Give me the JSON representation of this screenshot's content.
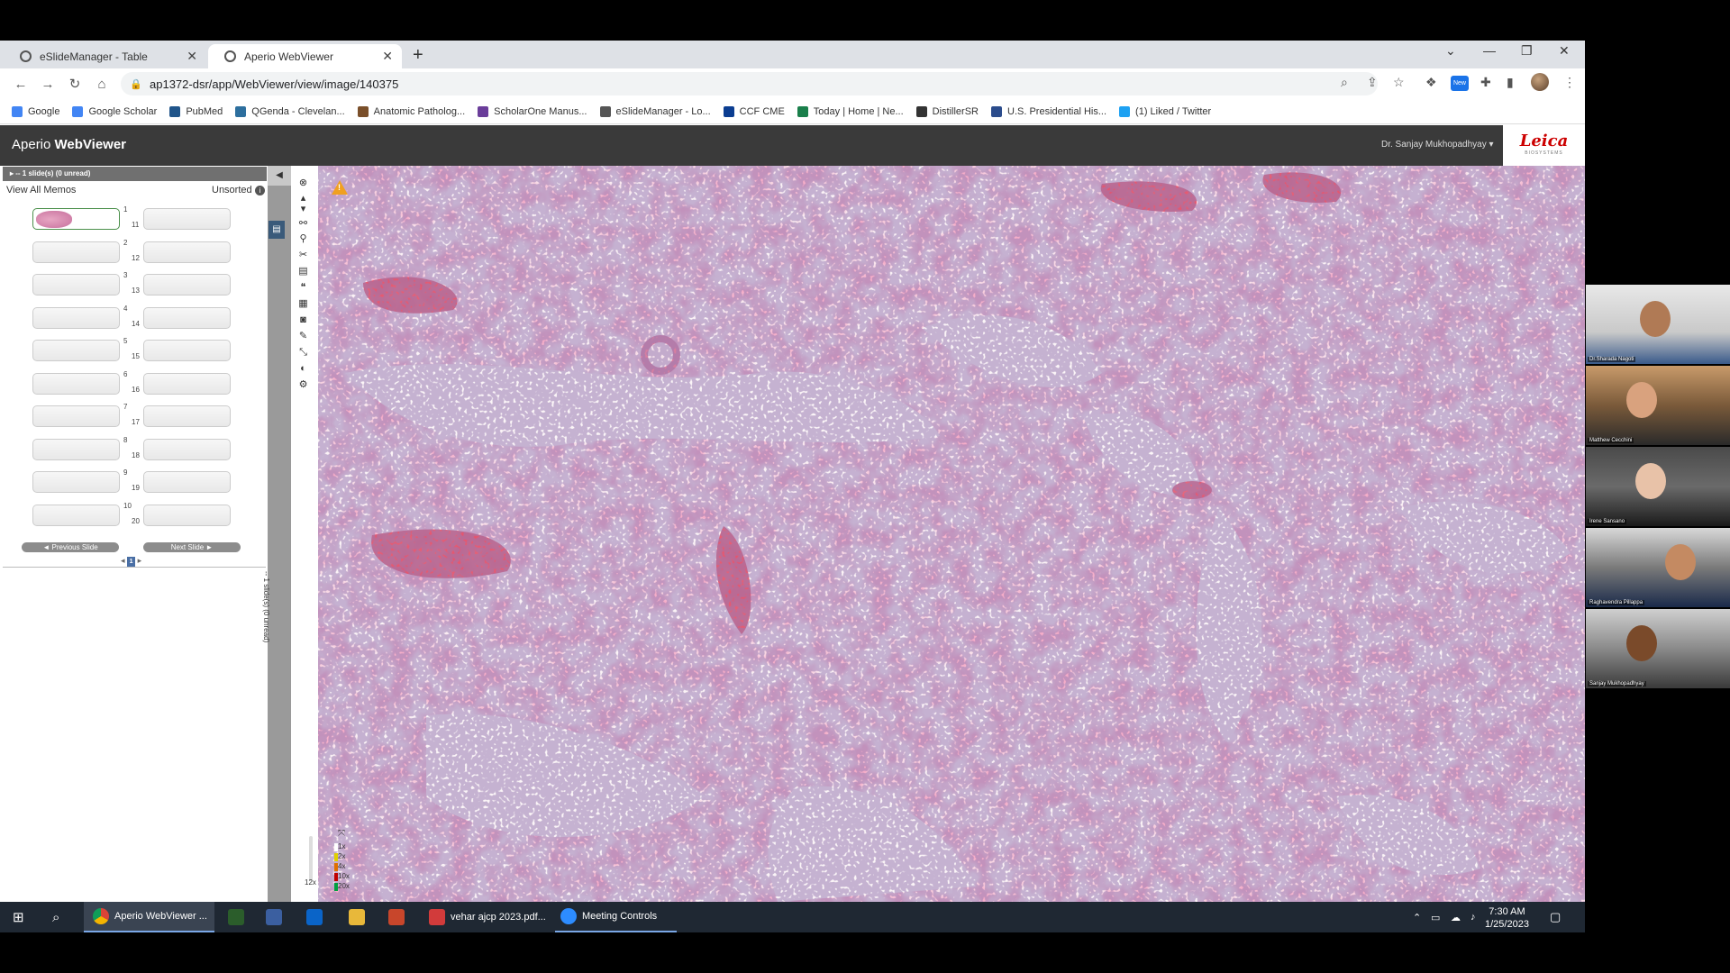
{
  "browser": {
    "tabs": [
      {
        "label": "eSlideManager - Table",
        "active": false
      },
      {
        "label": "Aperio WebViewer",
        "active": true
      }
    ],
    "url": "ap1372-dsr/app/WebViewer/view/image/140375",
    "new_badge": "New",
    "bookmarks": [
      {
        "label": "Google",
        "color": "#4285f4"
      },
      {
        "label": "Google Scholar",
        "color": "#4285f4"
      },
      {
        "label": "PubMed",
        "color": "#20558a"
      },
      {
        "label": "QGenda - Clevelan...",
        "color": "#2d6f9e"
      },
      {
        "label": "Anatomic Patholog...",
        "color": "#7a4f2a"
      },
      {
        "label": "ScholarOne Manus...",
        "color": "#6a3d9a"
      },
      {
        "label": "eSlideManager - Lo...",
        "color": "#555555"
      },
      {
        "label": "CCF CME",
        "color": "#0b3d91"
      },
      {
        "label": "Today | Home | Ne...",
        "color": "#1a7f4b"
      },
      {
        "label": "DistillerSR",
        "color": "#333333"
      },
      {
        "label": "U.S. Presidential His...",
        "color": "#2b4c8c"
      },
      {
        "label": "(1) Liked / Twitter",
        "color": "#1da1f2"
      }
    ]
  },
  "app": {
    "title_prefix": "Aperio ",
    "title_bold": "WebViewer",
    "user": "Dr. Sanjay Mukhopadhyay ▾",
    "logo": "Leica",
    "logo_sub": "BIOSYSTEMS"
  },
  "left_panel": {
    "header": "▸ -- 1 slide(s) (0 unread)",
    "view_all_memos": "View All Memos",
    "sort": "Unsorted",
    "info": "i",
    "slot_numbers_left": [
      "1",
      "2",
      "3",
      "4",
      "5",
      "6",
      "7",
      "8",
      "9",
      "10"
    ],
    "slot_numbers_right": [
      "11",
      "12",
      "13",
      "14",
      "15",
      "16",
      "17",
      "18",
      "19",
      "20"
    ],
    "prev_button": "◄  Previous Slide",
    "next_button": "Next Slide  ►",
    "pager_prev": "◂",
    "pager_current": "1",
    "pager_next": "▸",
    "collapse_vertical_text": "-- 1 slide(s) (0 unread)",
    "collapse_arrow": "◀"
  },
  "viewer": {
    "zoom_levels": [
      "1x",
      "2x",
      "4x",
      "10x",
      "20x"
    ],
    "zoom_colors": [
      "#ffffff",
      "#e0d000",
      "#e07000",
      "#c00000",
      "#00a040"
    ],
    "current_zoom": "12x",
    "warning": "!"
  },
  "taskbar": {
    "items": [
      {
        "label": "Aperio WebViewer ...",
        "active": true
      },
      {
        "label": "vehar ajcp 2023.pdf...",
        "active": false
      },
      {
        "label": "Meeting Controls",
        "active": false
      }
    ],
    "time": "7:30 AM",
    "date": "1/25/2023"
  },
  "participants": [
    {
      "name": "Dr.Sharada Nagoti"
    },
    {
      "name": "Matthew Cecchini"
    },
    {
      "name": "Irene Sansano"
    },
    {
      "name": "Raghavendra Pillappa"
    },
    {
      "name": "Sanjay Mukhopadhyay"
    }
  ]
}
